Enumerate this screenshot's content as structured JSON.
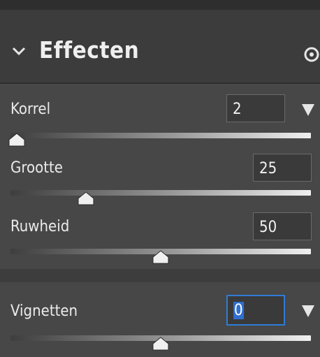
{
  "panel": {
    "title": "Effecten",
    "icons": {
      "collapse": "chevron-down-icon",
      "visibility": "eye-icon"
    },
    "colors": {
      "accent": "#2f7bd6",
      "panel_bg": "#474747",
      "header_bg": "#3c3c3c"
    }
  },
  "grain": {
    "label": "Korrel",
    "value": "2",
    "level": 0.02
  },
  "size": {
    "label": "Grootte",
    "value": "25",
    "level": 0.25
  },
  "roughness": {
    "label": "Ruwheid",
    "value": "50",
    "level": 0.5
  },
  "vignette": {
    "label": "Vignetten",
    "value": "0",
    "level": 0.5
  }
}
